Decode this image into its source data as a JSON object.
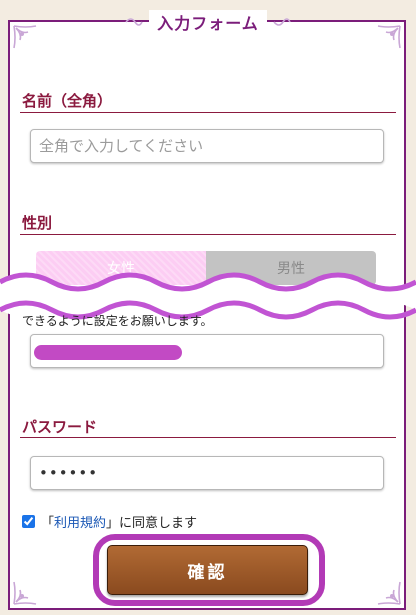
{
  "form": {
    "title": "入力フォーム"
  },
  "name_section": {
    "label": "名前（全角）",
    "placeholder": "全角で入力してください",
    "value": ""
  },
  "gender_section": {
    "label": "性別",
    "options": [
      "女性",
      "男性"
    ],
    "selected": "女性"
  },
  "contact_section": {
    "notice": "できるように設定をお願いします。"
  },
  "password_section": {
    "label": "パスワード",
    "value": "••••••"
  },
  "terms": {
    "checked": true,
    "open_bracket": "「",
    "link_label": "利用規約",
    "close_and_text": "」に同意します"
  },
  "confirm_button": {
    "label": "確認"
  },
  "colors": {
    "frame": "#7b1d7a",
    "section_label": "#8b1a3f",
    "female_selected": "#fccdf3",
    "male_unselected": "#c3c3c3",
    "highlight": "#b23ab6",
    "button_brown": "#8a4a1f"
  }
}
